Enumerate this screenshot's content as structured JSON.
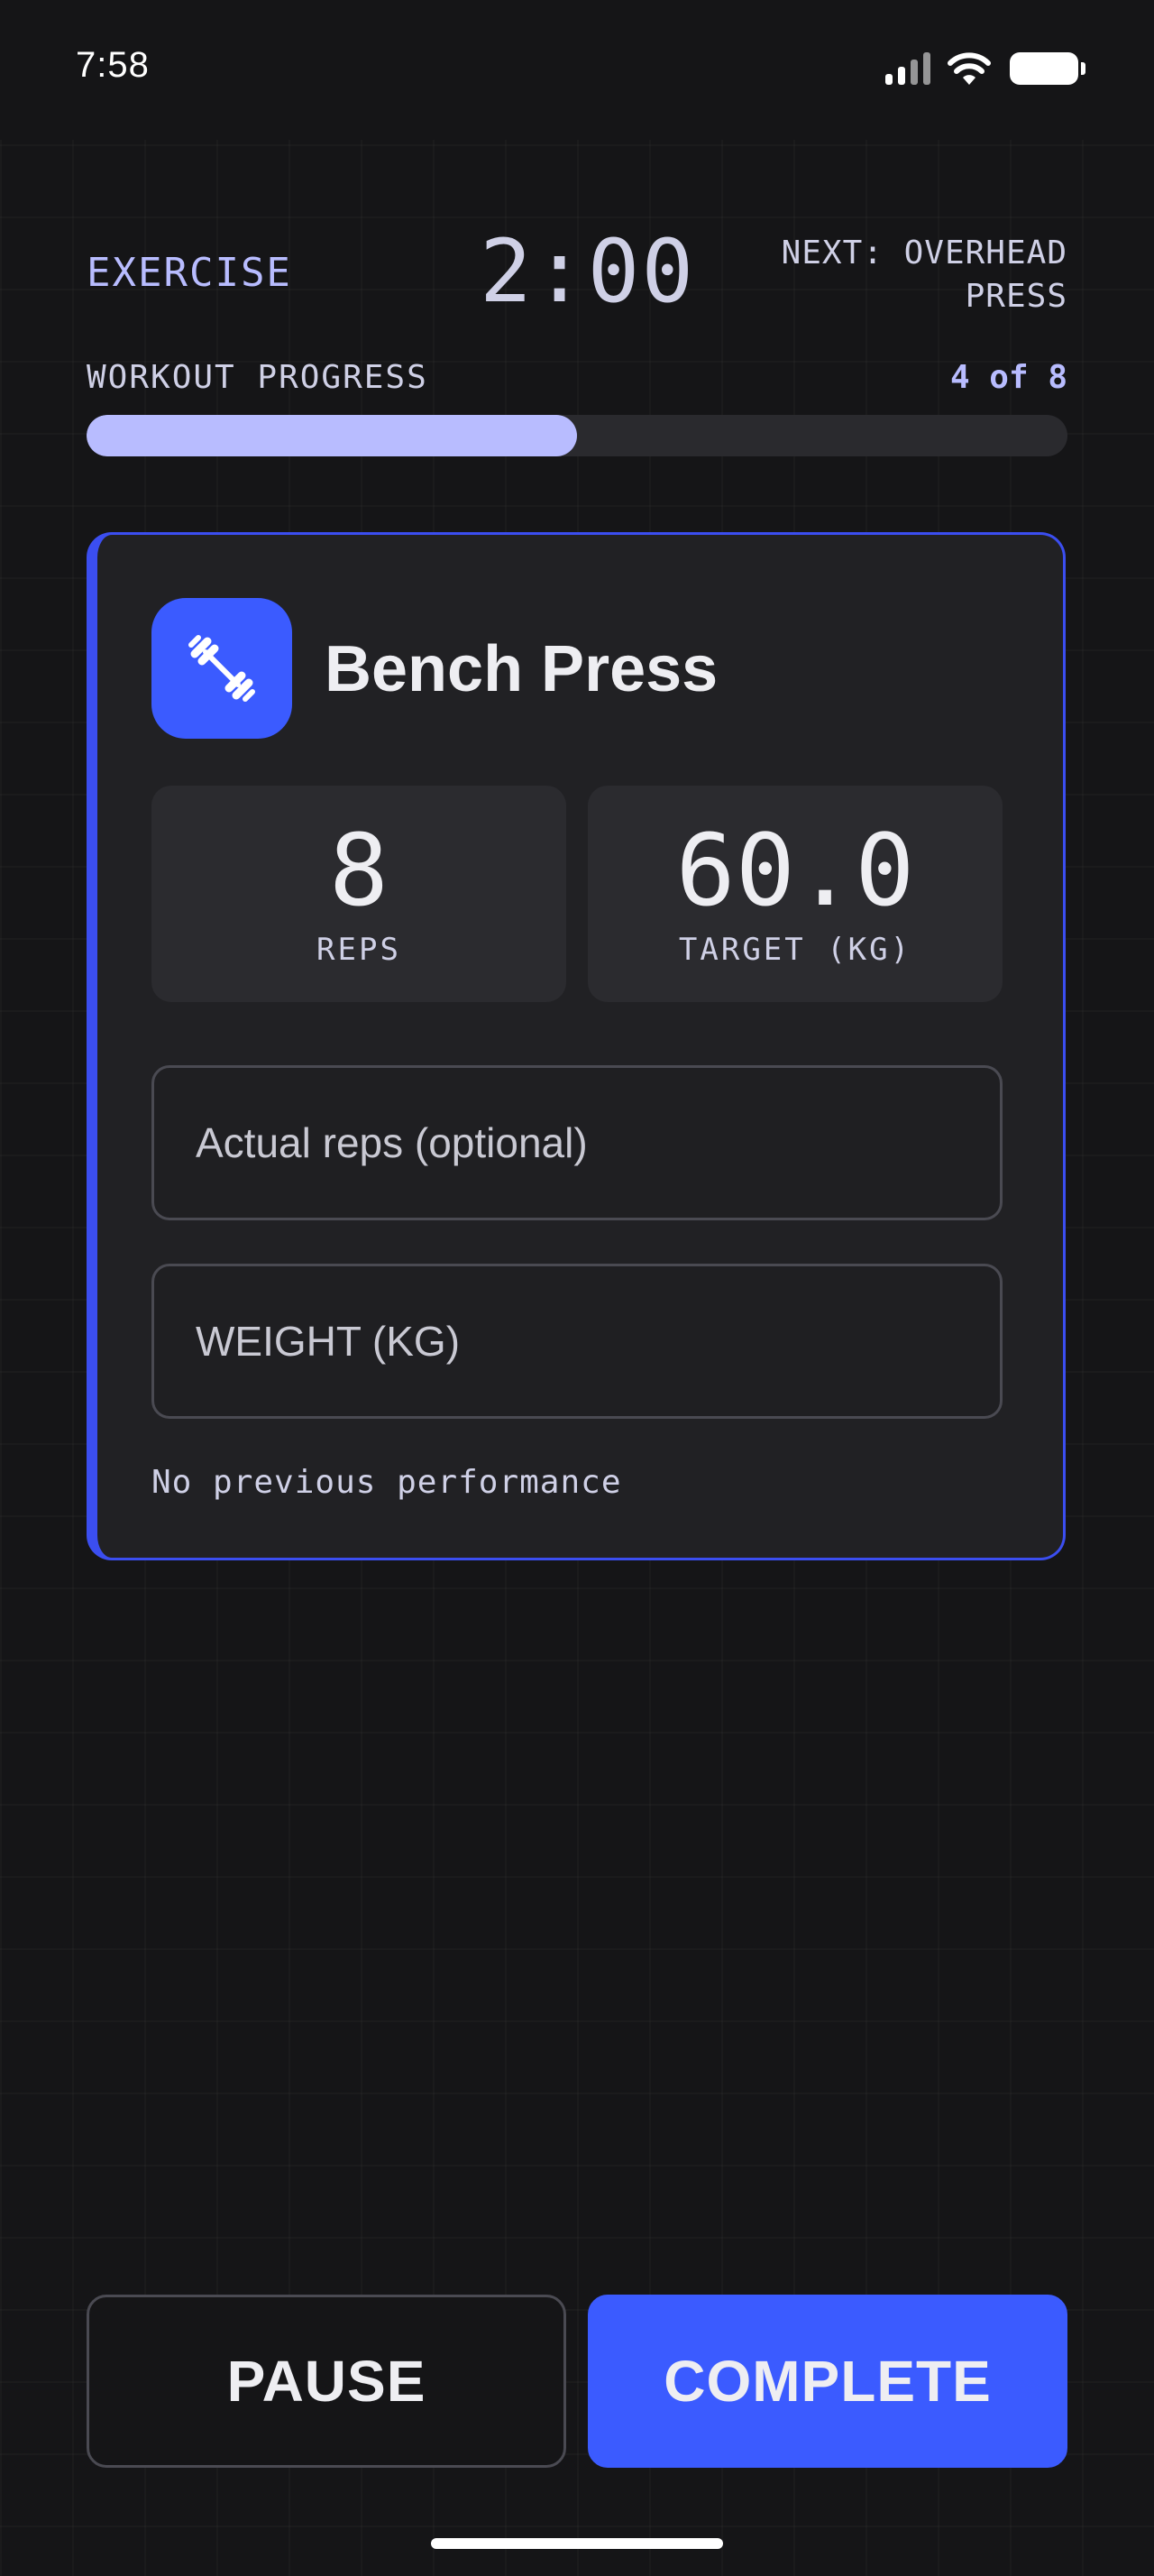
{
  "status_bar": {
    "time": "7:58",
    "icons": [
      "cellular-signal-icon",
      "wifi-icon",
      "battery-icon"
    ]
  },
  "header": {
    "exercise_label": "EXERCISE",
    "timer": "2:00",
    "next_label": "NEXT: OVERHEAD PRESS"
  },
  "progress": {
    "title": "WORKOUT PROGRESS",
    "count": "4 of 8",
    "fraction": 0.5
  },
  "card": {
    "icon": "dumbbell-icon",
    "title": "Bench Press",
    "stats": [
      {
        "value": "8",
        "label": "REPS"
      },
      {
        "value": "60.0",
        "label": "TARGET (KG)"
      }
    ],
    "inputs": {
      "reps_placeholder": "Actual reps (optional)",
      "weight_placeholder": "WEIGHT (KG)"
    },
    "previous": "No previous performance"
  },
  "actions": {
    "pause_label": "PAUSE",
    "complete_label": "COMPLETE"
  },
  "colors": {
    "background": "#151517",
    "accent": "#3b5bff",
    "accent_light": "#b8bcff",
    "card": "#212124"
  }
}
